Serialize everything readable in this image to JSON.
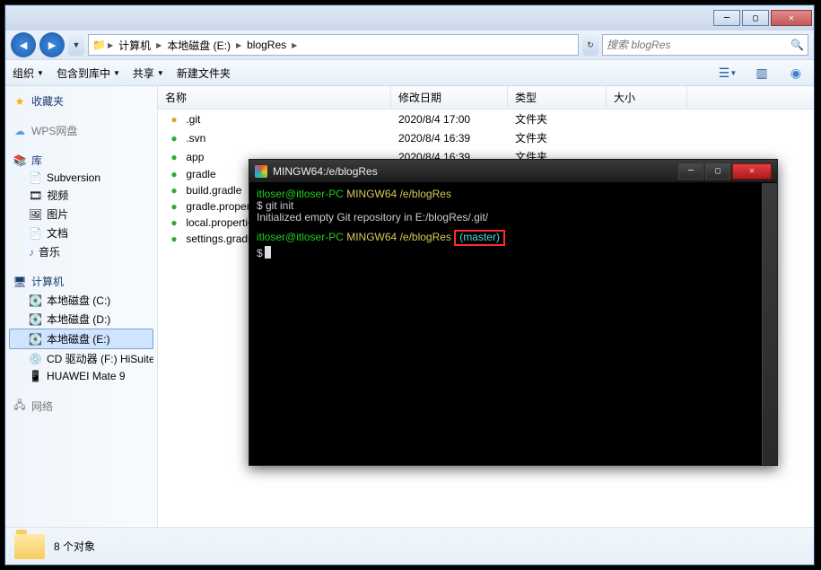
{
  "explorer": {
    "breadcrumb": [
      "计算机",
      "本地磁盘 (E:)",
      "blogRes"
    ],
    "search_placeholder": "搜索 blogRes",
    "toolbar": {
      "organize": "组织",
      "include": "包含到库中",
      "share": "共享",
      "newfolder": "新建文件夹"
    },
    "sidebar": {
      "favorites": "收藏夹",
      "wps": "WPS网盘",
      "libraries": "库",
      "lib_items": [
        "Subversion",
        "视频",
        "图片",
        "文档",
        "音乐"
      ],
      "computer": "计算机",
      "drives": [
        "本地磁盘 (C:)",
        "本地磁盘 (D:)",
        "本地磁盘 (E:)",
        "CD 驱动器 (F:) HiSuite",
        "HUAWEI Mate 9"
      ],
      "network": "网络"
    },
    "columns": {
      "name": "名称",
      "date": "修改日期",
      "type": "类型",
      "size": "大小"
    },
    "files": [
      {
        "icon": "●",
        "name": ".git",
        "date": "2020/8/4 17:00",
        "type": "文件夹",
        "size": ""
      },
      {
        "icon": "●",
        "name": ".svn",
        "date": "2020/8/4 16:39",
        "type": "文件夹",
        "size": ""
      },
      {
        "icon": "●",
        "name": "app",
        "date": "2020/8/4 16:39",
        "type": "文件夹",
        "size": ""
      },
      {
        "icon": "●",
        "name": "gradle",
        "date": "",
        "type": "",
        "size": ""
      },
      {
        "icon": "●",
        "name": "build.gradle",
        "date": "",
        "type": "",
        "size": ""
      },
      {
        "icon": "●",
        "name": "gradle.properties",
        "date": "",
        "type": "",
        "size": ""
      },
      {
        "icon": "●",
        "name": "local.properties",
        "date": "",
        "type": "",
        "size": ""
      },
      {
        "icon": "●",
        "name": "settings.gradle",
        "date": "",
        "type": "",
        "size": ""
      }
    ],
    "status": "8 个对象"
  },
  "terminal": {
    "title": "MINGW64:/e/blogRes",
    "line1_user": "itloser@itloser-PC",
    "line1_env": "MINGW64",
    "line1_path": "/e/blogRes",
    "line2": "$ git init",
    "line3": "Initialized empty Git repository in E:/blogRes/.git/",
    "line4_user": "itloser@itloser-PC",
    "line4_env": "MINGW64",
    "line4_path": "/e/blogRes",
    "line4_branch": "(master)",
    "line5": "$"
  }
}
